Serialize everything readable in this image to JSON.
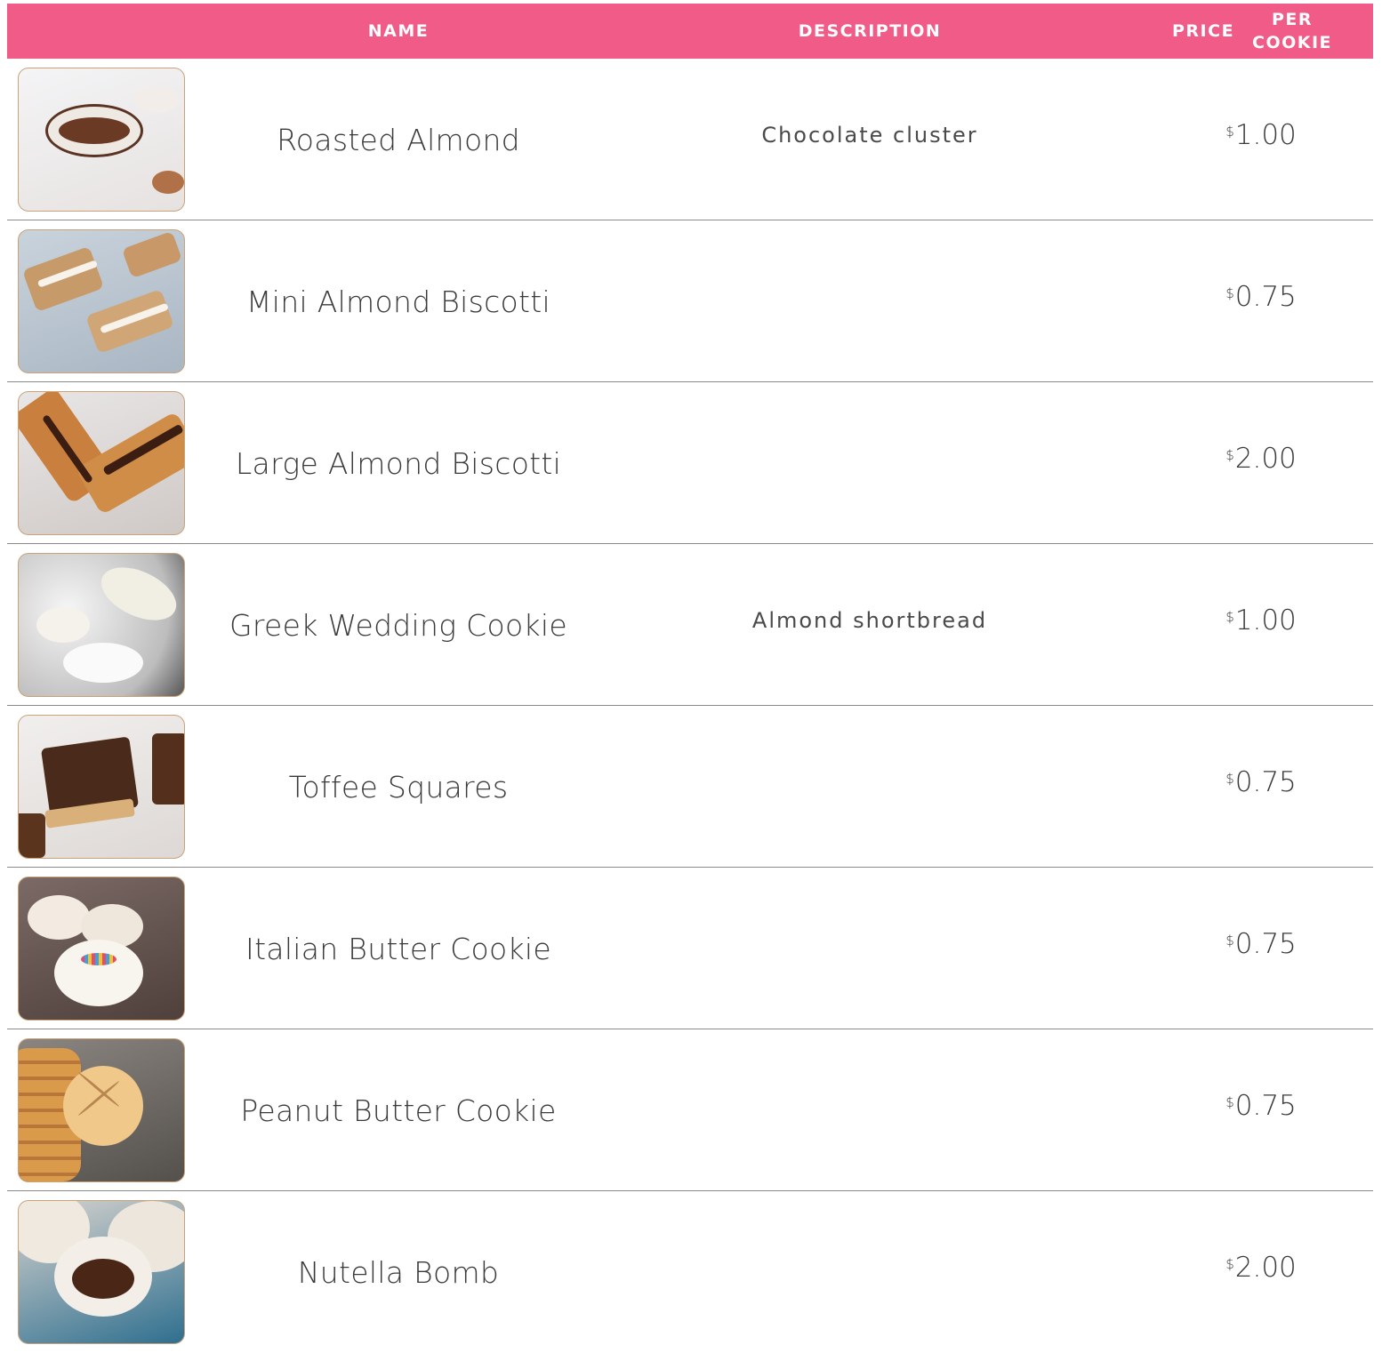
{
  "header": {
    "name": "NAME",
    "description": "DESCRIPTION",
    "price_line1": "PRICE",
    "price_line2": "PER COOKIE"
  },
  "colors": {
    "header_bg": "#f05c87",
    "divider": "#8a8a8a"
  },
  "items": [
    {
      "name": "Roasted Almond",
      "description": "Chocolate cluster",
      "currency": "$",
      "price": "1.00",
      "image": "chocolate-almond-cluster-photo"
    },
    {
      "name": "Mini Almond Biscotti",
      "description": "",
      "currency": "$",
      "price": "0.75",
      "image": "mini-biscotti-photo"
    },
    {
      "name": "Large Almond Biscotti",
      "description": "",
      "currency": "$",
      "price": "2.00",
      "image": "large-biscotti-photo"
    },
    {
      "name": "Greek Wedding Cookie",
      "description": "Almond shortbread",
      "currency": "$",
      "price": "1.00",
      "image": "wedding-cookie-photo"
    },
    {
      "name": "Toffee Squares",
      "description": "",
      "currency": "$",
      "price": "0.75",
      "image": "toffee-squares-photo"
    },
    {
      "name": "Italian Butter Cookie",
      "description": "",
      "currency": "$",
      "price": "0.75",
      "image": "butter-cookie-photo"
    },
    {
      "name": "Peanut Butter Cookie",
      "description": "",
      "currency": "$",
      "price": "0.75",
      "image": "peanut-butter-cookie-photo"
    },
    {
      "name": "Nutella Bomb",
      "description": "",
      "currency": "$",
      "price": "2.00",
      "image": "nutella-bomb-photo"
    }
  ]
}
